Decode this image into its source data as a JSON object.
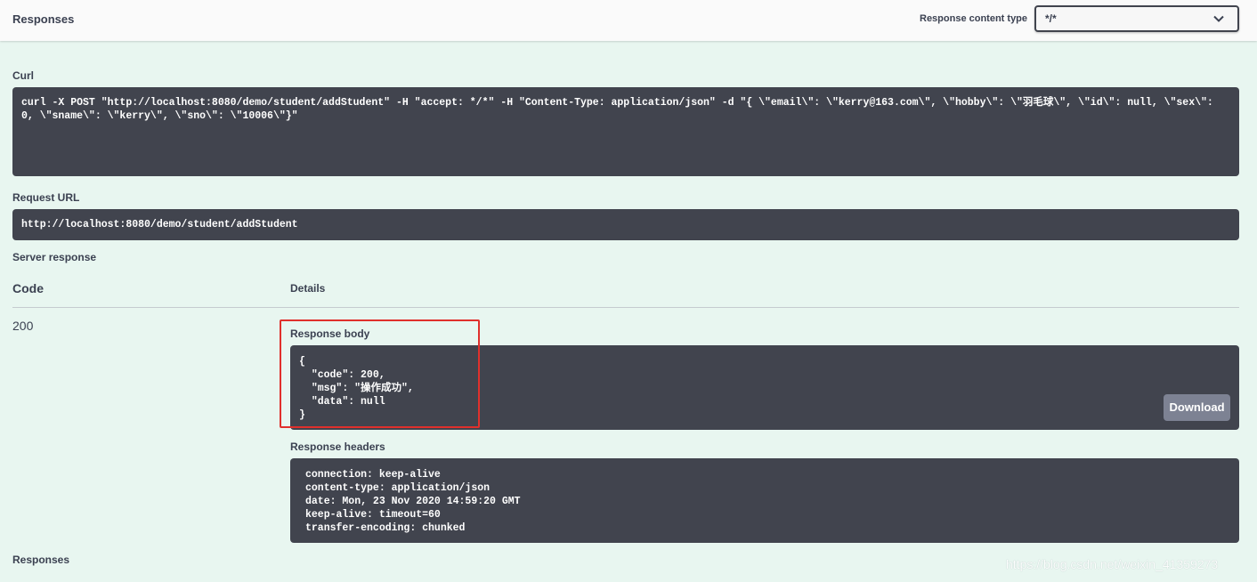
{
  "header": {
    "title": "Responses",
    "content_type_label": "Response content type",
    "content_type_value": "*/*"
  },
  "curl": {
    "label": "Curl",
    "command": "curl -X POST \"http://localhost:8080/demo/student/addStudent\" -H \"accept: */*\" -H \"Content-Type: application/json\" -d \"{ \\\"email\\\": \\\"kerry@163.com\\\", \\\"hobby\\\": \\\"羽毛球\\\", \\\"id\\\": null, \\\"sex\\\": 0, \\\"sname\\\": \\\"kerry\\\", \\\"sno\\\": \\\"10006\\\"}\""
  },
  "request_url": {
    "label": "Request URL",
    "value": "http://localhost:8080/demo/student/addStudent"
  },
  "server_response": {
    "label": "Server response",
    "code_header": "Code",
    "details_header": "Details",
    "status_code": "200",
    "response_body_label": "Response body",
    "response_body": "{\n  \"code\": 200,\n  \"msg\": \"操作成功\",\n  \"data\": null\n}",
    "download_label": "Download",
    "response_headers_label": "Response headers",
    "response_headers": "connection: keep-alive\ncontent-type: application/json\ndate: Mon, 23 Nov 2020 14:59:20 GMT\nkeep-alive: timeout=60\ntransfer-encoding: chunked"
  },
  "footer": {
    "responses_label": "Responses",
    "watermark": "https://blog.csdn.net/weixin_41359273"
  },
  "colors": {
    "background": "#e8f6f0",
    "code_block": "#41444e",
    "highlight": "#e0302c",
    "download_button": "#7d8293"
  }
}
